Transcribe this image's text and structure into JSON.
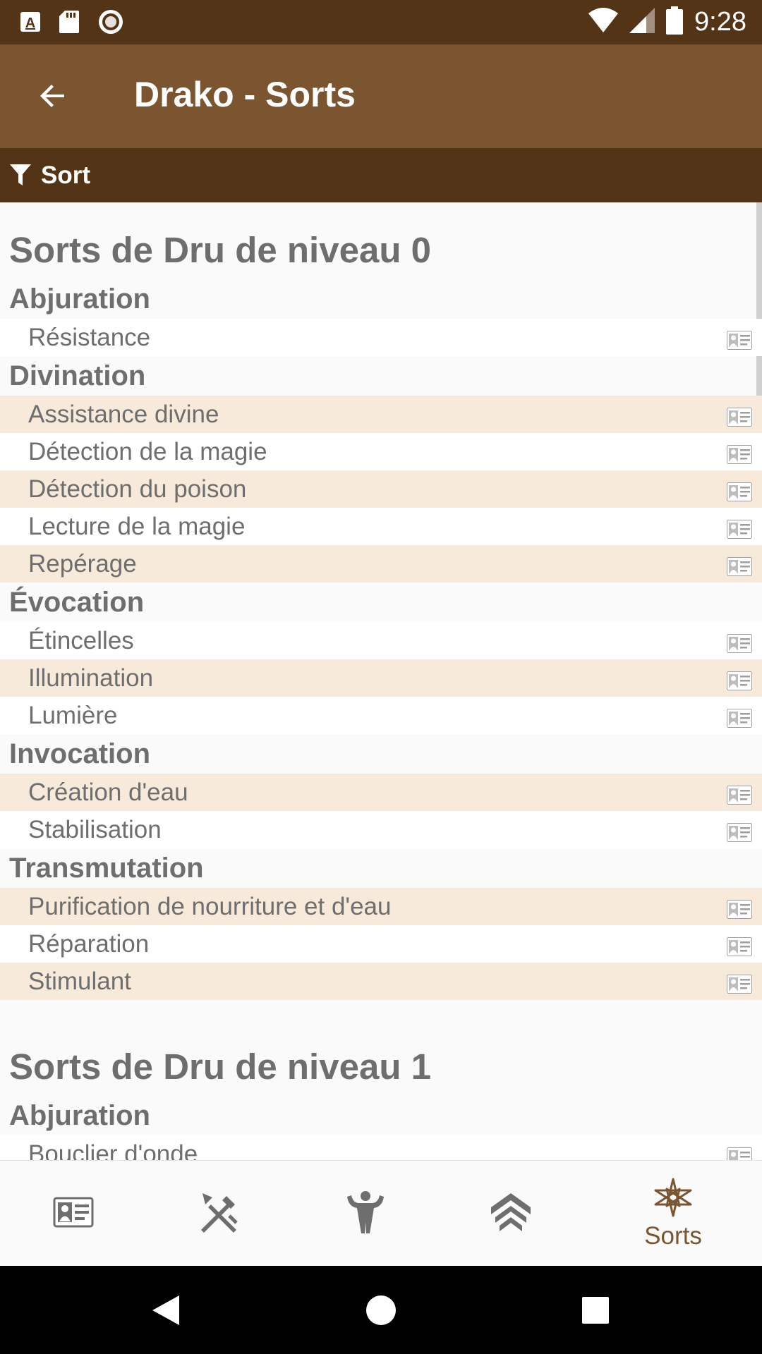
{
  "status_bar": {
    "time": "9:28",
    "icons": [
      "a-box-icon",
      "sd-card-icon",
      "record-icon",
      "wifi-icon",
      "signal-icon",
      "battery-icon"
    ]
  },
  "app_bar": {
    "title": "Drako - Sorts",
    "back_icon": "arrow-back-icon"
  },
  "filter_bar": {
    "label": "Sort",
    "icon": "filter-icon"
  },
  "levels": [
    {
      "title": "Sorts de Dru de niveau 0",
      "schools": [
        {
          "name": "Abjuration",
          "spells": [
            "Résistance"
          ]
        },
        {
          "name": "Divination",
          "spells": [
            "Assistance divine",
            "Détection de la magie",
            "Détection du poison",
            "Lecture de la magie",
            "Repérage"
          ]
        },
        {
          "name": "Évocation",
          "spells": [
            "Étincelles",
            "Illumination",
            "Lumière"
          ]
        },
        {
          "name": "Invocation",
          "spells": [
            "Création d'eau",
            "Stabilisation"
          ]
        },
        {
          "name": "Transmutation",
          "spells": [
            "Purification de nourriture et d'eau",
            "Réparation",
            "Stimulant"
          ]
        }
      ]
    },
    {
      "title": "Sorts de Dru de niveau 1",
      "schools": [
        {
          "name": "Abjuration",
          "spells": [
            "Bouclier d'onde"
          ]
        }
      ]
    }
  ],
  "bottom_nav": {
    "items": [
      {
        "icon": "character-card-icon"
      },
      {
        "icon": "crossed-weapons-icon"
      },
      {
        "icon": "strongman-icon"
      },
      {
        "icon": "rank-chevrons-icon"
      },
      {
        "icon": "heptagram-icon",
        "label": "Sorts",
        "active": true
      }
    ]
  },
  "colors": {
    "status_bar": "#543416",
    "app_bar": "#7a5530",
    "row_highlight": "#f7eadb",
    "active_tab": "#7a5530"
  }
}
